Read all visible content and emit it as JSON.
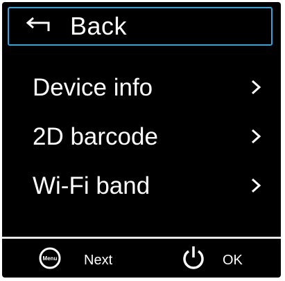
{
  "header": {
    "back_icon": "return-arrow-icon",
    "back_label": "Back",
    "highlight_color": "#2aa8e0"
  },
  "menu": {
    "items": [
      {
        "label": "Device info",
        "icon": "chevron-right-icon"
      },
      {
        "label": "2D barcode",
        "icon": "chevron-right-icon"
      },
      {
        "label": "Wi-Fi band",
        "icon": "chevron-right-icon"
      }
    ]
  },
  "footer": {
    "menu_button_icon": "menu-button-icon",
    "menu_button_text": "Menu",
    "next_label": "Next",
    "power_icon": "power-icon",
    "ok_label": "OK"
  }
}
